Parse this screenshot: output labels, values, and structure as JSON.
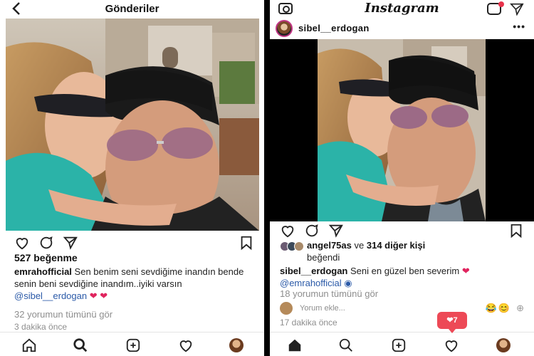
{
  "left": {
    "header": {
      "title": "Gönderiler",
      "back_icon": "chevron-left-icon"
    },
    "likes": "527 beğenme",
    "caption": {
      "username": "emrahofficial",
      "text": "Sen benim seni sevdiğime inandın bende senin beni sevdiğine inandım..iyiki varsın",
      "mention": "@sibel__erdogan"
    },
    "view_comments": "32 yorumun tümünü gör",
    "timestamp": "3 dakika önce"
  },
  "right": {
    "header": {
      "logo": "Instagram"
    },
    "profile": {
      "username": "sibel__erdogan",
      "more": "•••"
    },
    "liked_by": {
      "user": "angel75as",
      "joiner": "ve",
      "others": "314 diğer kişi",
      "suffix": "beğendi"
    },
    "caption": {
      "username": "sibel__erdogan",
      "text": "Seni en güzel ben severim",
      "mention": "@emrahofficial"
    },
    "view_comments": "18 yorumun tümünü gör",
    "comment_placeholder": "Yorum ekle...",
    "timestamp": "17 dakika önce",
    "activity": {
      "count": "7"
    }
  },
  "colors": {
    "like_red": "#ed4956",
    "mention_blue": "#2b5aa8",
    "muted": "#8e8e8e"
  }
}
